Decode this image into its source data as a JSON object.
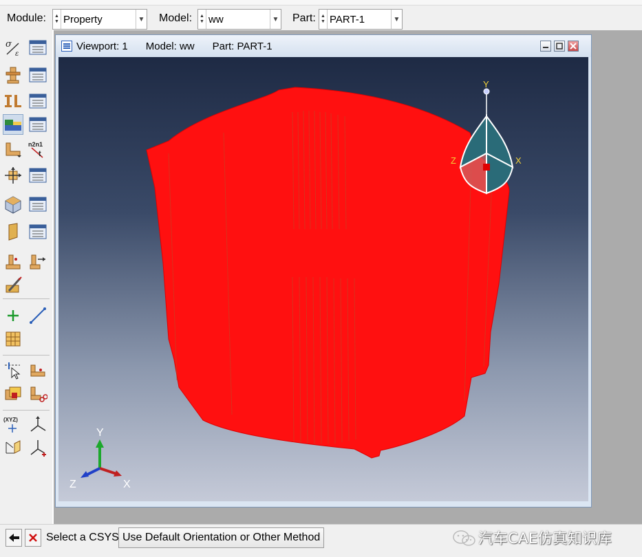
{
  "context_bar": {
    "module_label": "Module:",
    "module_value": "Property",
    "model_label": "Model:",
    "model_value": "ww",
    "part_label": "Part:",
    "part_value": "PART-1"
  },
  "viewport": {
    "name": "Viewport: 1",
    "model": "Model: ww",
    "part": "Part: PART-1",
    "scene": {
      "part_color": "#ff0000",
      "background_top": "#1e2a44",
      "background_bottom": "#c5cad8",
      "triad": {
        "y": "Y",
        "z": "Z",
        "x": "X"
      },
      "view_cube": {
        "y": "Y",
        "z": "Z",
        "x": "X"
      }
    }
  },
  "toolbox": {
    "icons": [
      "create-material-icon",
      "material-manager-icon",
      "create-section-icon",
      "section-manager-icon",
      "create-profile-icon",
      "profile-manager-icon",
      "assign-section-icon",
      "section-assignment-manager-icon",
      "assign-beam-orientation-icon",
      "assign-normal-icon",
      "assign-material-orientation-icon",
      "orientation-manager-icon",
      "skin-icon",
      "skin-manager-icon",
      "stringer-icon",
      "stringer-manager-icon",
      "special-engineering-icon",
      "inertia-icon",
      "composite-layup-icon",
      "datum-point-icon",
      "datum-axis-icon",
      "partition-icon",
      "query-icon",
      "set-manager-icon",
      "repair-icon",
      "geometry-edit-icon",
      "csys-icon",
      "triad-icon",
      "transform-icon",
      "datum-csys-icon"
    ]
  },
  "prompt": {
    "back_icon": "back-arrow-icon",
    "cancel_icon": "cancel-x-icon",
    "text": "Select a CSYS",
    "button_label": "Use Default Orientation or Other Method"
  },
  "watermark": {
    "text": "汽车CAE仿真知识库"
  }
}
